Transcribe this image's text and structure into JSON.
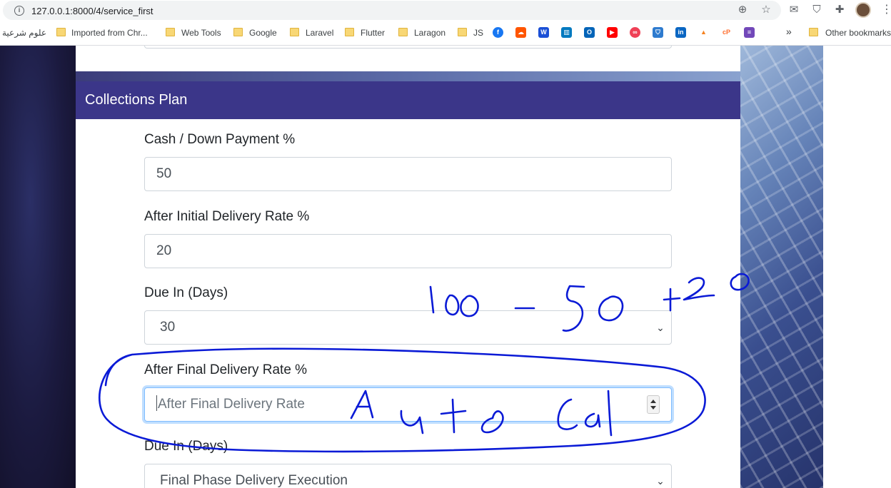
{
  "browser": {
    "url": "127.0.0.1:8000/4/service_first",
    "bookmarks": [
      {
        "label": "علوم شرعية"
      },
      {
        "label": "Imported from Chr..."
      },
      {
        "label": "Web Tools"
      },
      {
        "label": "Google"
      },
      {
        "label": "Laravel"
      },
      {
        "label": "Flutter"
      },
      {
        "label": "Laragon"
      },
      {
        "label": "JS"
      }
    ],
    "more": "»",
    "other_bookmarks": "Other bookmarks"
  },
  "card": {
    "title": "Collections Plan",
    "fields": {
      "down_payment": {
        "label": "Cash / Down Payment %",
        "value": "50"
      },
      "initial_delivery": {
        "label": "After Initial Delivery Rate %",
        "value": "20"
      },
      "due_in_1": {
        "label": "Due In (Days)",
        "value": "30"
      },
      "final_delivery": {
        "label": "After Final Delivery Rate %",
        "placeholder": "After Final Delivery Rate"
      },
      "due_in_2": {
        "label": "Due In (Days)",
        "value": "Final Phase Delivery Execution"
      }
    }
  },
  "colors": {
    "header": "#3b3689",
    "ink": "#0a1ad6",
    "focus_border": "#80bdff"
  }
}
